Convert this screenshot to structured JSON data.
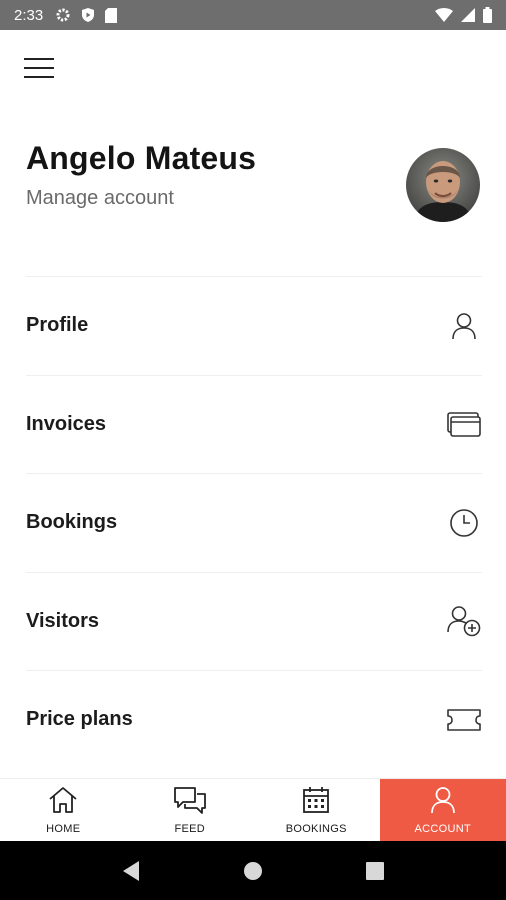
{
  "status_bar": {
    "time": "2:33",
    "left_icons": [
      "gear-icon",
      "play-protect-icon",
      "sd-card-icon"
    ],
    "right_icons": [
      "wifi-icon",
      "signal-icon",
      "battery-icon"
    ]
  },
  "header": {
    "menu_icon": "hamburger-menu-icon"
  },
  "profile": {
    "name": "Angelo Mateus",
    "subtitle": "Manage account"
  },
  "menu": {
    "items": [
      {
        "label": "Profile",
        "icon": "user-icon"
      },
      {
        "label": "Invoices",
        "icon": "wallet-icon"
      },
      {
        "label": "Bookings",
        "icon": "clock-icon"
      },
      {
        "label": "Visitors",
        "icon": "add-user-icon"
      },
      {
        "label": "Price plans",
        "icon": "ticket-icon"
      }
    ]
  },
  "bottom_nav": {
    "tabs": [
      {
        "label": "HOME",
        "icon": "home-icon",
        "active": false
      },
      {
        "label": "FEED",
        "icon": "chat-icon",
        "active": false
      },
      {
        "label": "BOOKINGS",
        "icon": "calendar-icon",
        "active": false
      },
      {
        "label": "ACCOUNT",
        "icon": "user-icon",
        "active": true
      }
    ],
    "active_color": "#ef5a45"
  },
  "system_nav": {
    "buttons": [
      "back-icon",
      "home-circle-icon",
      "recents-icon"
    ]
  }
}
